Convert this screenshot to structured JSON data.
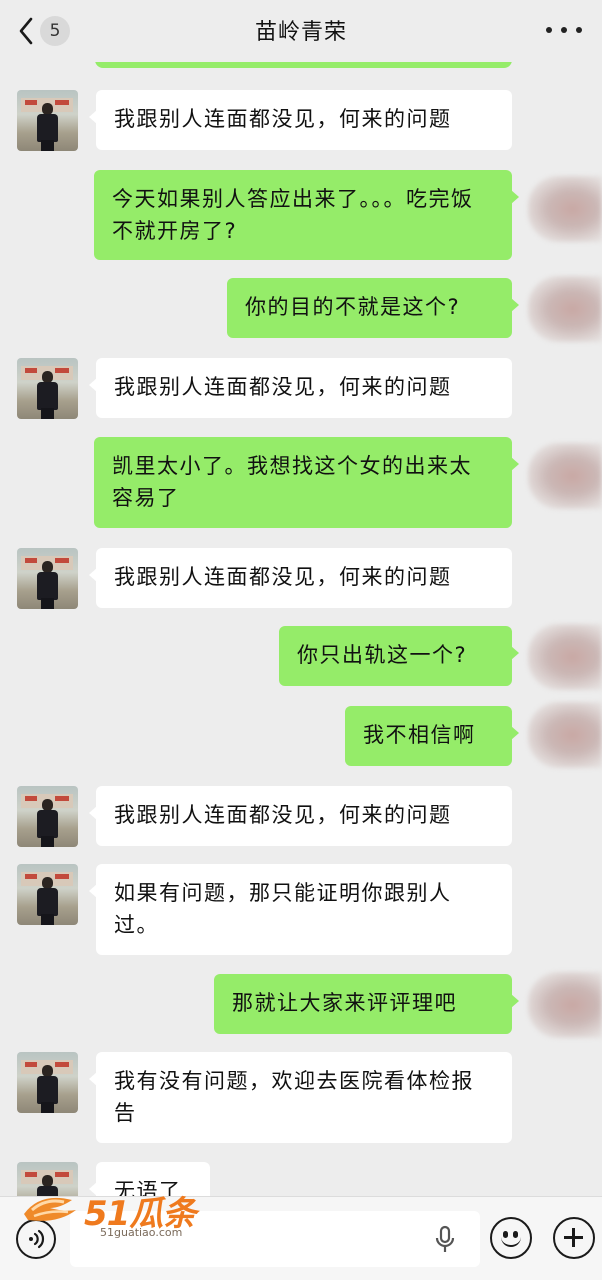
{
  "header": {
    "unread_count": "5",
    "title": "苗岭青荣"
  },
  "messages": [
    {
      "side": "in",
      "text": "我跟别人连面都没见，何来的问题"
    },
    {
      "side": "out",
      "text": "今天如果别人答应出来了。。。吃完饭不就开房了?"
    },
    {
      "side": "out",
      "text": "你的目的不就是这个?"
    },
    {
      "side": "in",
      "text": "我跟别人连面都没见，何来的问题"
    },
    {
      "side": "out",
      "text": "凯里太小了。我想找这个女的出来太容易了"
    },
    {
      "side": "in",
      "text": "我跟别人连面都没见，何来的问题"
    },
    {
      "side": "out",
      "text": "你只出轨这一个?"
    },
    {
      "side": "out",
      "text": "我不相信啊"
    },
    {
      "side": "in",
      "text": "我跟别人连面都没见，何来的问题"
    },
    {
      "side": "in",
      "text": "如果有问题，那只能证明你跟别人过。"
    },
    {
      "side": "out",
      "text": "那就让大家来评评理吧"
    },
    {
      "side": "in",
      "text": "我有没有问题，欢迎去医院看体检报告"
    },
    {
      "side": "in",
      "text": "无语了"
    }
  ],
  "watermark": {
    "brand": "51瓜条",
    "url": "51guatiao.com"
  },
  "icons": {
    "back": "chevron-left-icon",
    "more": "more-dots-icon",
    "voice": "voice-icon",
    "mic": "mic-icon",
    "emoji": "emoji-icon",
    "plus": "plus-icon"
  },
  "colors": {
    "outgoing_bubble": "#95ec69",
    "incoming_bubble": "#ffffff",
    "background": "#ededed"
  }
}
